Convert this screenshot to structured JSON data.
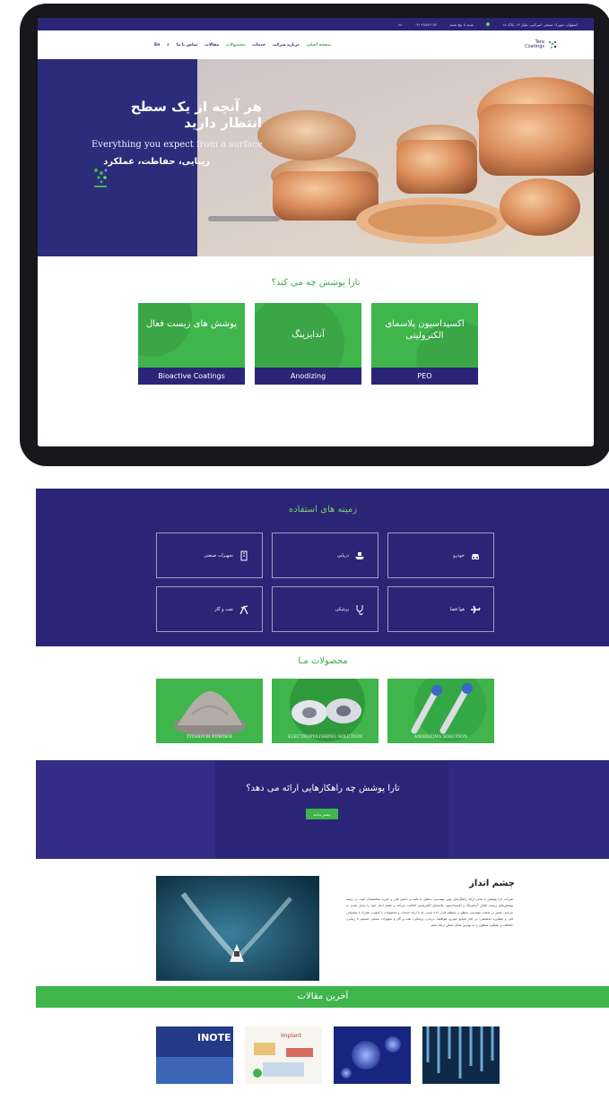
{
  "topbar": {
    "address": "اصفهان، شهرک صنعتی امیرکبیر، بلوار ۱۷، پلاک ۱۸",
    "hours": "شنبه تا پنج شنبه",
    "phone": "۰۳۱-۴۲۵۴۶۱۷۴",
    "extra": "۸۸"
  },
  "nav": {
    "items": [
      "صفحه اصلی",
      "درباره شرکت",
      "خدمات",
      "محصولات",
      "مقالات",
      "تماس با ما"
    ],
    "lang": "En",
    "search": "⌕"
  },
  "logo": {
    "line1": "Tara",
    "line2": "Coatings"
  },
  "hero": {
    "title": "هر آنچه از یک سطح انتظار دارید",
    "subtitle": "Everything you expect from a surface",
    "tagline": "زیبایی، حفاظت، عملکرد"
  },
  "services": {
    "title": "تارا پوشش چه می کند؟",
    "cards": [
      {
        "fa": "پوشش های زیست فعال",
        "en": "Bioactive Coatings"
      },
      {
        "fa": "آندایزینگ",
        "en": "Anodizing"
      },
      {
        "fa": "اکسیداسیون پلاسمای الکترولیتی",
        "en": "PEO"
      }
    ]
  },
  "usage": {
    "title": "زمینه های استفاده",
    "items": [
      {
        "label": "تجهیزات صنعتی",
        "icon": "factory-icon"
      },
      {
        "label": "دریایی",
        "icon": "ship-icon"
      },
      {
        "label": "خودرو",
        "icon": "car-icon"
      },
      {
        "label": "نفت و گاز",
        "icon": "oil-pump-icon"
      },
      {
        "label": "پزشکی",
        "icon": "stethoscope-icon"
      },
      {
        "label": "هوا فضا",
        "icon": "airplane-icon"
      }
    ]
  },
  "products": {
    "title": "محصولات مـا",
    "items": [
      {
        "caption": "TITANIUM POWDER"
      },
      {
        "caption": "ELECTROPOLISHING SOLUTION"
      },
      {
        "caption": "ANODIZING SOLUTION"
      }
    ]
  },
  "cta": {
    "text": "تارا پوشش چه راهکارهایی ارائه می دهد؟",
    "button": "بیشتر بدانید"
  },
  "vision": {
    "title": "چشم انداز",
    "body": "شرکت تارا پوشش با هدف ارائه راهکارهای نوین مهندسی سطح، با تکیه بر دانش فنی و تجربه متخصصان خود، در زمینه پوشش‌های زیست فعال، آندایزینگ و اکسیداسیون پلاسمای الکترولیتی فعالیت می‌کند و چشم انداز خود را تبدیل شدن به مرجعی معتبر در صنعت مهندسی سطح در منطقه قرار داده است. ما با ارائه خدمات و محصولات با کیفیت، همراه با پشتیبانی فنی و مشاوره تخصصی، در کنار صنایع خودرو، هوافضا، دریایی، پزشکی، نفت و گاز و تجهیزات صنعتی هستیم تا زیبایی، حفاظت و عملکرد سطوح را به بهترین شکل ممکن ارتقا دهیم."
  },
  "articles": {
    "title": "آخرین مقالات",
    "items": [
      {
        "label": "INOTE"
      },
      {
        "label": "Implant"
      },
      {
        "label": ""
      },
      {
        "label": ""
      }
    ]
  },
  "colors": {
    "navy": "#2b2577",
    "green": "#3fb54c"
  }
}
